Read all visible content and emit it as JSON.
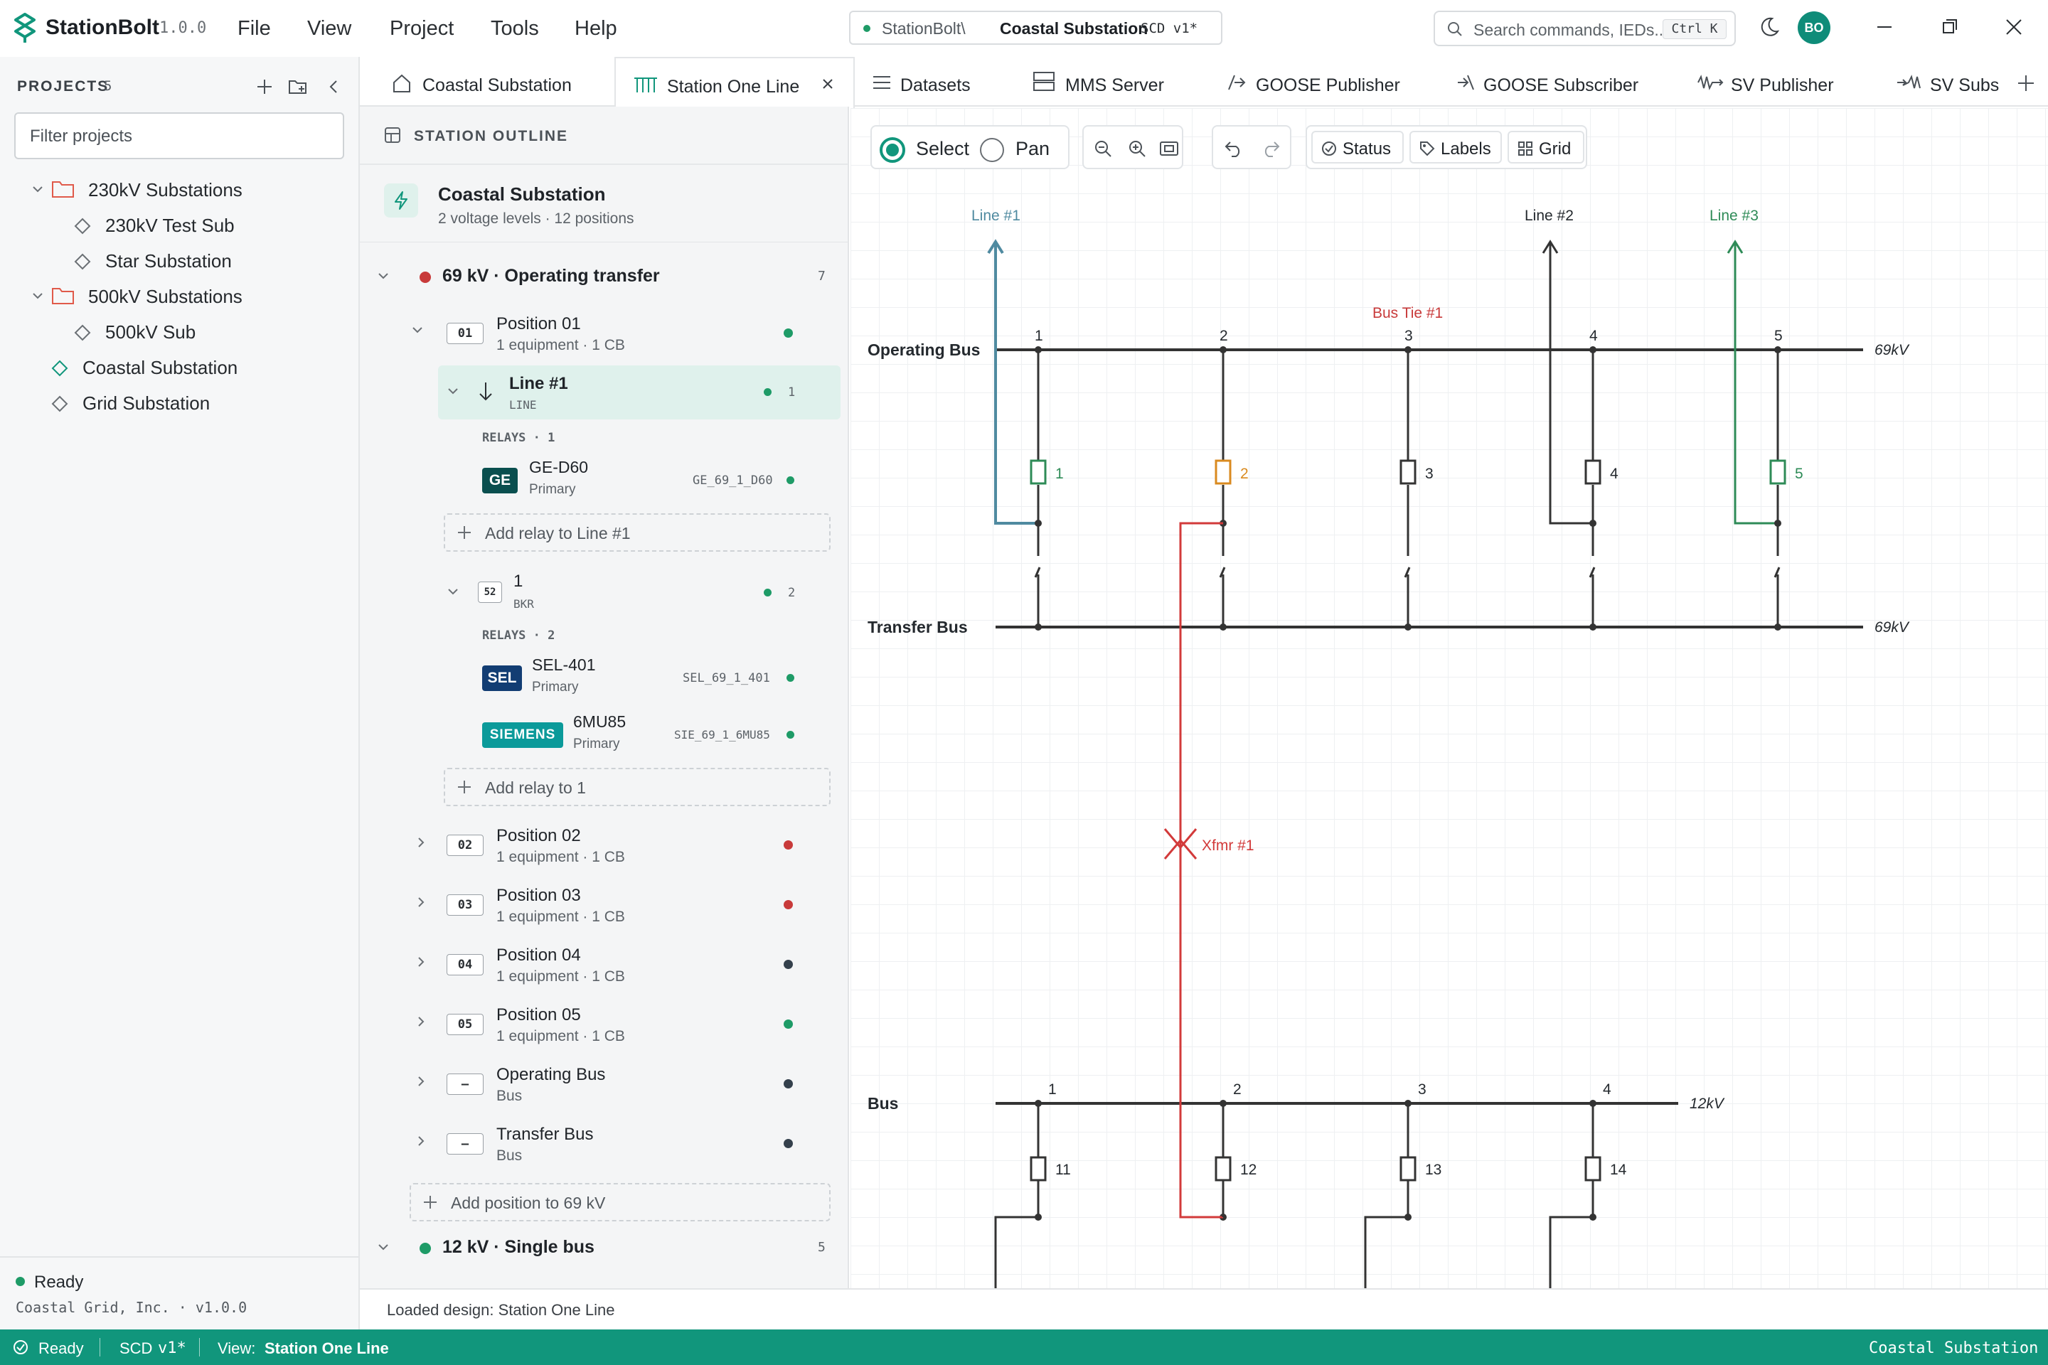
{
  "app": {
    "name": "StationBolt",
    "version": "1.0.0"
  },
  "menu": [
    "File",
    "View",
    "Project",
    "Tools",
    "Help"
  ],
  "path": {
    "prefix": "StationBolt\\",
    "name": "Coastal Substation",
    "badge": "SCD v1*"
  },
  "search": {
    "placeholder": "Search commands, IEDs...",
    "shortcut": "Ctrl K"
  },
  "user": {
    "initials": "BO"
  },
  "sidebar": {
    "header": "PROJECTS",
    "count": "5",
    "filter_placeholder": "Filter projects",
    "items": [
      {
        "label": "230kV Substations",
        "type": "folder"
      },
      {
        "label": "230kV Test Sub",
        "type": "sub"
      },
      {
        "label": "Star Substation",
        "type": "sub"
      },
      {
        "label": "500kV Substations",
        "type": "folder"
      },
      {
        "label": "500kV Sub",
        "type": "sub"
      },
      {
        "label": "Coastal Substation",
        "type": "sub"
      },
      {
        "label": "Grid Substation",
        "type": "sub"
      }
    ],
    "status": "Ready",
    "company": "Coastal Grid, Inc. · v1.0.0"
  },
  "tabs": [
    {
      "label": "Coastal Substation"
    },
    {
      "label": "Station One Line"
    },
    {
      "label": "Datasets"
    },
    {
      "label": "MMS Server"
    },
    {
      "label": "GOOSE Publisher"
    },
    {
      "label": "GOOSE Subscriber"
    },
    {
      "label": "SV Publisher"
    },
    {
      "label": "SV Subs"
    }
  ],
  "outline": {
    "header": "STATION OUTLINE",
    "station": {
      "name": "Coastal Substation",
      "summary": "2 voltage levels · 12 positions"
    },
    "voltage1": {
      "label": "69 kV · Operating transfer",
      "count": "7"
    },
    "pos01": {
      "num": "01",
      "name": "Position 01",
      "sub": "1 equipment · 1 CB"
    },
    "line1": {
      "name": "Line #1",
      "type": "LINE",
      "count": "1"
    },
    "relays1_label": "RELAYS · 1",
    "relay_ge": {
      "badge": "GE",
      "name": "GE-D60",
      "role": "Primary",
      "id": "GE_69_1_D60"
    },
    "add_relay_line": "Add relay to Line #1",
    "bkr": {
      "badge": "52",
      "name": "1",
      "type": "BKR",
      "count": "2"
    },
    "relays2_label": "RELAYS · 2",
    "relay_sel": {
      "badge": "SEL",
      "name": "SEL-401",
      "role": "Primary",
      "id": "SEL_69_1_401"
    },
    "relay_sie": {
      "badge": "SIEMENS",
      "name": "6MU85",
      "role": "Primary",
      "id": "SIE_69_1_6MU85"
    },
    "add_relay_1": "Add relay to 1",
    "positions": [
      {
        "num": "02",
        "name": "Position 02",
        "sub": "1 equipment · 1 CB"
      },
      {
        "num": "03",
        "name": "Position 03",
        "sub": "1 equipment · 1 CB"
      },
      {
        "num": "04",
        "name": "Position 04",
        "sub": "1 equipment · 1 CB"
      },
      {
        "num": "05",
        "name": "Position 05",
        "sub": "1 equipment · 1 CB"
      },
      {
        "num": "–",
        "name": "Operating Bus",
        "sub": "Bus"
      },
      {
        "num": "–",
        "name": "Transfer Bus",
        "sub": "Bus"
      }
    ],
    "add_position": "Add position to 69 kV",
    "voltage2": {
      "label": "12 kV · Single bus",
      "count": "5"
    }
  },
  "toolbar": {
    "select": "Select",
    "pan": "Pan",
    "status": "Status",
    "labels": "Labels",
    "grid": "Grid"
  },
  "diagram": {
    "line1": "Line #1",
    "line2": "Line #2",
    "line3": "Line #3",
    "bustie": "Bus Tie #1",
    "opbus": "Operating Bus",
    "trbus": "Transfer Bus",
    "bus": "Bus",
    "kv69a": "69kV",
    "kv69b": "69kV",
    "kv12": "12kV",
    "xfmr": "Xfmr #1",
    "top_nums": [
      "1",
      "2",
      "3",
      "4",
      "5"
    ],
    "cb_nums": [
      "1",
      "2",
      "3",
      "4",
      "5"
    ],
    "bot_nums": [
      "1",
      "2",
      "3",
      "4"
    ],
    "cb_bot": [
      "11",
      "12",
      "13",
      "14"
    ]
  },
  "footer": "Loaded design: Station One Line",
  "statusbar": {
    "ready": "Ready",
    "scd": "SCD",
    "ver": "v1*",
    "view_label": "View:",
    "view": "Station One Line",
    "right": "Coastal Substation"
  },
  "colors": {
    "accent": "#11967c",
    "line1": "#4f8aa0",
    "line3": "#2e8b57",
    "xfmr": "#d23a3a",
    "cb2": "#d98a1f"
  }
}
